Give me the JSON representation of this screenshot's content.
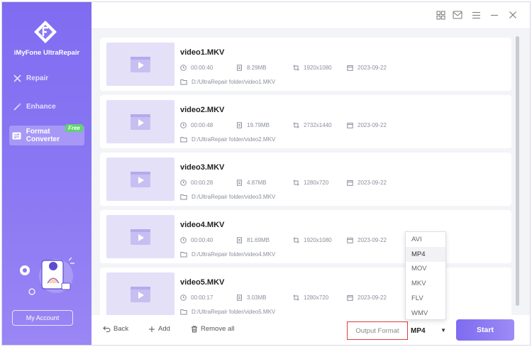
{
  "app": {
    "name": "iMyFone UltraRepair"
  },
  "sidebar": {
    "items": [
      {
        "label": "Repair",
        "icon": "tools-icon"
      },
      {
        "label": "Enhance",
        "icon": "magic-wand-icon"
      },
      {
        "label": "Format Converter",
        "icon": "convert-icon",
        "badge": "Free",
        "active": true
      }
    ],
    "account_label": "My Account"
  },
  "videos": [
    {
      "name": "video1.MKV",
      "duration": "00:00:40",
      "size": "8.29MB",
      "resolution": "1920x1080",
      "date": "2023-09-22",
      "path": "D:/UltraRepair folder/video1.MKV"
    },
    {
      "name": "video2.MKV",
      "duration": "00:00:48",
      "size": "19.79MB",
      "resolution": "2732x1440",
      "date": "2023-09-22",
      "path": "D:/UltraRepair folder/video2.MKV"
    },
    {
      "name": "video3.MKV",
      "duration": "00:00:28",
      "size": "4.87MB",
      "resolution": "1280x720",
      "date": "2023-09-22",
      "path": "D:/UltraRepair folder/video3.MKV"
    },
    {
      "name": "video4.MKV",
      "duration": "00:00:40",
      "size": "81.69MB",
      "resolution": "1920x1080",
      "date": "2023-09-22",
      "path": "D:/UltraRepair folder/video4.MKV"
    },
    {
      "name": "video5.MKV",
      "duration": "00:00:17",
      "size": "3.03MB",
      "resolution": "1280x720",
      "date": "2023-09-22",
      "path": "D:/UltraRepair folder/video5.MKV"
    }
  ],
  "bottombar": {
    "back_label": "Back",
    "add_label": "Add",
    "remove_all_label": "Remove all",
    "output_format_label": "Output Format",
    "selected_format": "MP4",
    "start_label": "Start"
  },
  "format_options": [
    "AVI",
    "MP4",
    "MOV",
    "MKV",
    "FLV",
    "WMV"
  ],
  "colors": {
    "accent": "#7f6cf1",
    "free_badge": "#5fd36d",
    "highlight_border": "#e23c3c"
  }
}
